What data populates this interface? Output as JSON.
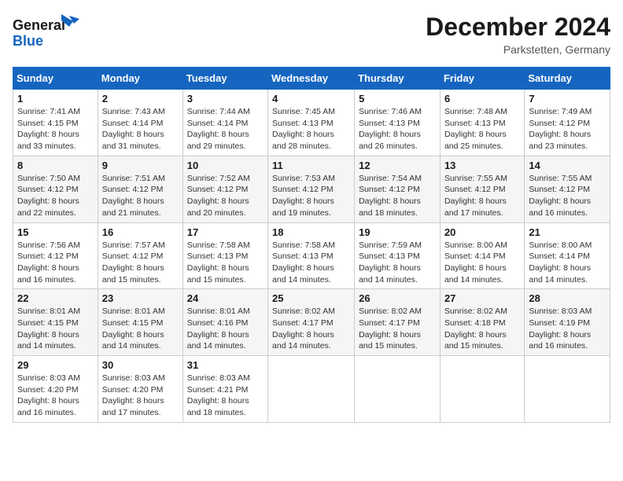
{
  "header": {
    "logo_line1": "General",
    "logo_line2": "Blue",
    "month": "December 2024",
    "location": "Parkstetten, Germany"
  },
  "weekdays": [
    "Sunday",
    "Monday",
    "Tuesday",
    "Wednesday",
    "Thursday",
    "Friday",
    "Saturday"
  ],
  "weeks": [
    [
      {
        "day": "1",
        "sunrise": "Sunrise: 7:41 AM",
        "sunset": "Sunset: 4:15 PM",
        "daylight": "Daylight: 8 hours and 33 minutes."
      },
      {
        "day": "2",
        "sunrise": "Sunrise: 7:43 AM",
        "sunset": "Sunset: 4:14 PM",
        "daylight": "Daylight: 8 hours and 31 minutes."
      },
      {
        "day": "3",
        "sunrise": "Sunrise: 7:44 AM",
        "sunset": "Sunset: 4:14 PM",
        "daylight": "Daylight: 8 hours and 29 minutes."
      },
      {
        "day": "4",
        "sunrise": "Sunrise: 7:45 AM",
        "sunset": "Sunset: 4:13 PM",
        "daylight": "Daylight: 8 hours and 28 minutes."
      },
      {
        "day": "5",
        "sunrise": "Sunrise: 7:46 AM",
        "sunset": "Sunset: 4:13 PM",
        "daylight": "Daylight: 8 hours and 26 minutes."
      },
      {
        "day": "6",
        "sunrise": "Sunrise: 7:48 AM",
        "sunset": "Sunset: 4:13 PM",
        "daylight": "Daylight: 8 hours and 25 minutes."
      },
      {
        "day": "7",
        "sunrise": "Sunrise: 7:49 AM",
        "sunset": "Sunset: 4:12 PM",
        "daylight": "Daylight: 8 hours and 23 minutes."
      }
    ],
    [
      {
        "day": "8",
        "sunrise": "Sunrise: 7:50 AM",
        "sunset": "Sunset: 4:12 PM",
        "daylight": "Daylight: 8 hours and 22 minutes."
      },
      {
        "day": "9",
        "sunrise": "Sunrise: 7:51 AM",
        "sunset": "Sunset: 4:12 PM",
        "daylight": "Daylight: 8 hours and 21 minutes."
      },
      {
        "day": "10",
        "sunrise": "Sunrise: 7:52 AM",
        "sunset": "Sunset: 4:12 PM",
        "daylight": "Daylight: 8 hours and 20 minutes."
      },
      {
        "day": "11",
        "sunrise": "Sunrise: 7:53 AM",
        "sunset": "Sunset: 4:12 PM",
        "daylight": "Daylight: 8 hours and 19 minutes."
      },
      {
        "day": "12",
        "sunrise": "Sunrise: 7:54 AM",
        "sunset": "Sunset: 4:12 PM",
        "daylight": "Daylight: 8 hours and 18 minutes."
      },
      {
        "day": "13",
        "sunrise": "Sunrise: 7:55 AM",
        "sunset": "Sunset: 4:12 PM",
        "daylight": "Daylight: 8 hours and 17 minutes."
      },
      {
        "day": "14",
        "sunrise": "Sunrise: 7:55 AM",
        "sunset": "Sunset: 4:12 PM",
        "daylight": "Daylight: 8 hours and 16 minutes."
      }
    ],
    [
      {
        "day": "15",
        "sunrise": "Sunrise: 7:56 AM",
        "sunset": "Sunset: 4:12 PM",
        "daylight": "Daylight: 8 hours and 16 minutes."
      },
      {
        "day": "16",
        "sunrise": "Sunrise: 7:57 AM",
        "sunset": "Sunset: 4:12 PM",
        "daylight": "Daylight: 8 hours and 15 minutes."
      },
      {
        "day": "17",
        "sunrise": "Sunrise: 7:58 AM",
        "sunset": "Sunset: 4:13 PM",
        "daylight": "Daylight: 8 hours and 15 minutes."
      },
      {
        "day": "18",
        "sunrise": "Sunrise: 7:58 AM",
        "sunset": "Sunset: 4:13 PM",
        "daylight": "Daylight: 8 hours and 14 minutes."
      },
      {
        "day": "19",
        "sunrise": "Sunrise: 7:59 AM",
        "sunset": "Sunset: 4:13 PM",
        "daylight": "Daylight: 8 hours and 14 minutes."
      },
      {
        "day": "20",
        "sunrise": "Sunrise: 8:00 AM",
        "sunset": "Sunset: 4:14 PM",
        "daylight": "Daylight: 8 hours and 14 minutes."
      },
      {
        "day": "21",
        "sunrise": "Sunrise: 8:00 AM",
        "sunset": "Sunset: 4:14 PM",
        "daylight": "Daylight: 8 hours and 14 minutes."
      }
    ],
    [
      {
        "day": "22",
        "sunrise": "Sunrise: 8:01 AM",
        "sunset": "Sunset: 4:15 PM",
        "daylight": "Daylight: 8 hours and 14 minutes."
      },
      {
        "day": "23",
        "sunrise": "Sunrise: 8:01 AM",
        "sunset": "Sunset: 4:15 PM",
        "daylight": "Daylight: 8 hours and 14 minutes."
      },
      {
        "day": "24",
        "sunrise": "Sunrise: 8:01 AM",
        "sunset": "Sunset: 4:16 PM",
        "daylight": "Daylight: 8 hours and 14 minutes."
      },
      {
        "day": "25",
        "sunrise": "Sunrise: 8:02 AM",
        "sunset": "Sunset: 4:17 PM",
        "daylight": "Daylight: 8 hours and 14 minutes."
      },
      {
        "day": "26",
        "sunrise": "Sunrise: 8:02 AM",
        "sunset": "Sunset: 4:17 PM",
        "daylight": "Daylight: 8 hours and 15 minutes."
      },
      {
        "day": "27",
        "sunrise": "Sunrise: 8:02 AM",
        "sunset": "Sunset: 4:18 PM",
        "daylight": "Daylight: 8 hours and 15 minutes."
      },
      {
        "day": "28",
        "sunrise": "Sunrise: 8:03 AM",
        "sunset": "Sunset: 4:19 PM",
        "daylight": "Daylight: 8 hours and 16 minutes."
      }
    ],
    [
      {
        "day": "29",
        "sunrise": "Sunrise: 8:03 AM",
        "sunset": "Sunset: 4:20 PM",
        "daylight": "Daylight: 8 hours and 16 minutes."
      },
      {
        "day": "30",
        "sunrise": "Sunrise: 8:03 AM",
        "sunset": "Sunset: 4:20 PM",
        "daylight": "Daylight: 8 hours and 17 minutes."
      },
      {
        "day": "31",
        "sunrise": "Sunrise: 8:03 AM",
        "sunset": "Sunset: 4:21 PM",
        "daylight": "Daylight: 8 hours and 18 minutes."
      },
      null,
      null,
      null,
      null
    ]
  ]
}
